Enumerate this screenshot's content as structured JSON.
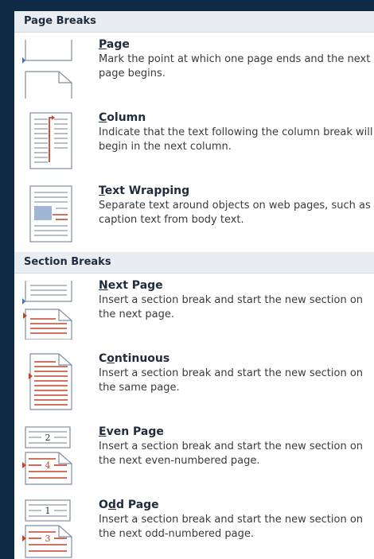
{
  "sections": {
    "page_breaks": {
      "header": "Page Breaks",
      "items": [
        {
          "ul": "P",
          "rest": "age",
          "desc": "Mark the point at which one page ends and the next page begins."
        },
        {
          "ul": "C",
          "rest": "olumn",
          "desc": "Indicate that the text following the column break will begin in the next column."
        },
        {
          "ul": "T",
          "rest": "ext Wrapping",
          "desc": "Separate text around objects on web pages, such as caption text from body text."
        }
      ]
    },
    "section_breaks": {
      "header": "Section Breaks",
      "items": [
        {
          "ul": "N",
          "rest": "ext Page",
          "desc": "Insert a section break and start the new section on the next page."
        },
        {
          "pre": "C",
          "ul": "o",
          "rest": "ntinuous",
          "desc": "Insert a section break and start the new section on the same page."
        },
        {
          "ul": "E",
          "rest": "ven Page",
          "desc": "Insert a section break and start the new section on the next even-numbered page.",
          "nums": [
            "2",
            "4"
          ]
        },
        {
          "pre": "O",
          "ul": "d",
          "rest": "d Page",
          "desc": "Insert a section break and start the new section on the next odd-numbered page.",
          "nums": [
            "1",
            "3"
          ]
        }
      ]
    }
  },
  "colors": {
    "accent_red": "#c4432b",
    "accent_blue": "#3b73b9",
    "page_line": "#7f8fa3"
  },
  "icons": [
    "page-break-icon",
    "column-break-icon",
    "text-wrapping-break-icon",
    "next-page-section-icon",
    "continuous-section-icon",
    "even-page-section-icon",
    "odd-page-section-icon"
  ]
}
